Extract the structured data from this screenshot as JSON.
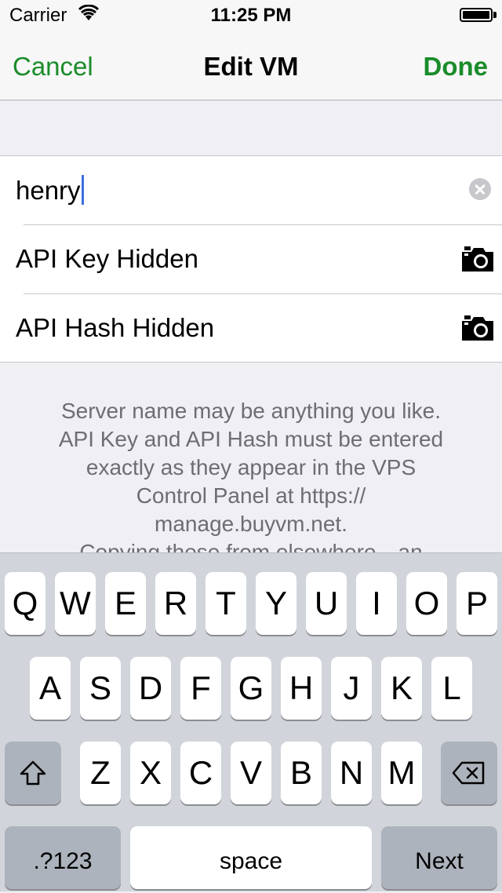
{
  "status_bar": {
    "carrier": "Carrier",
    "time": "11:25 PM"
  },
  "nav": {
    "cancel": "Cancel",
    "title": "Edit VM",
    "done": "Done"
  },
  "form": {
    "name_value": "henry",
    "api_key_label": "API Key Hidden",
    "api_hash_label": "API Hash Hidden"
  },
  "footer": {
    "lines": [
      "Server name may be anything you like.",
      "API Key and API Hash must be entered",
      "exactly as they appear in the VPS",
      "Control Panel at https://",
      "manage.buyvm.net.",
      "Copying these from elsewhere—an"
    ]
  },
  "keyboard": {
    "row1": [
      "Q",
      "W",
      "E",
      "R",
      "T",
      "Y",
      "U",
      "I",
      "O",
      "P"
    ],
    "row2": [
      "A",
      "S",
      "D",
      "F",
      "G",
      "H",
      "J",
      "K",
      "L"
    ],
    "row3": [
      "Z",
      "X",
      "C",
      "V",
      "B",
      "N",
      "M"
    ],
    "mode_key": ".?123",
    "space_key": "space",
    "return_key": "Next"
  },
  "icons": {
    "shift": "shift-icon",
    "delete": "delete-icon",
    "camera": "camera-icon",
    "clear": "clear-icon",
    "wifi": "wifi-icon",
    "battery": "battery-icon"
  },
  "colors": {
    "accent": "#1a8c2a",
    "caret": "#3b6fe0"
  }
}
